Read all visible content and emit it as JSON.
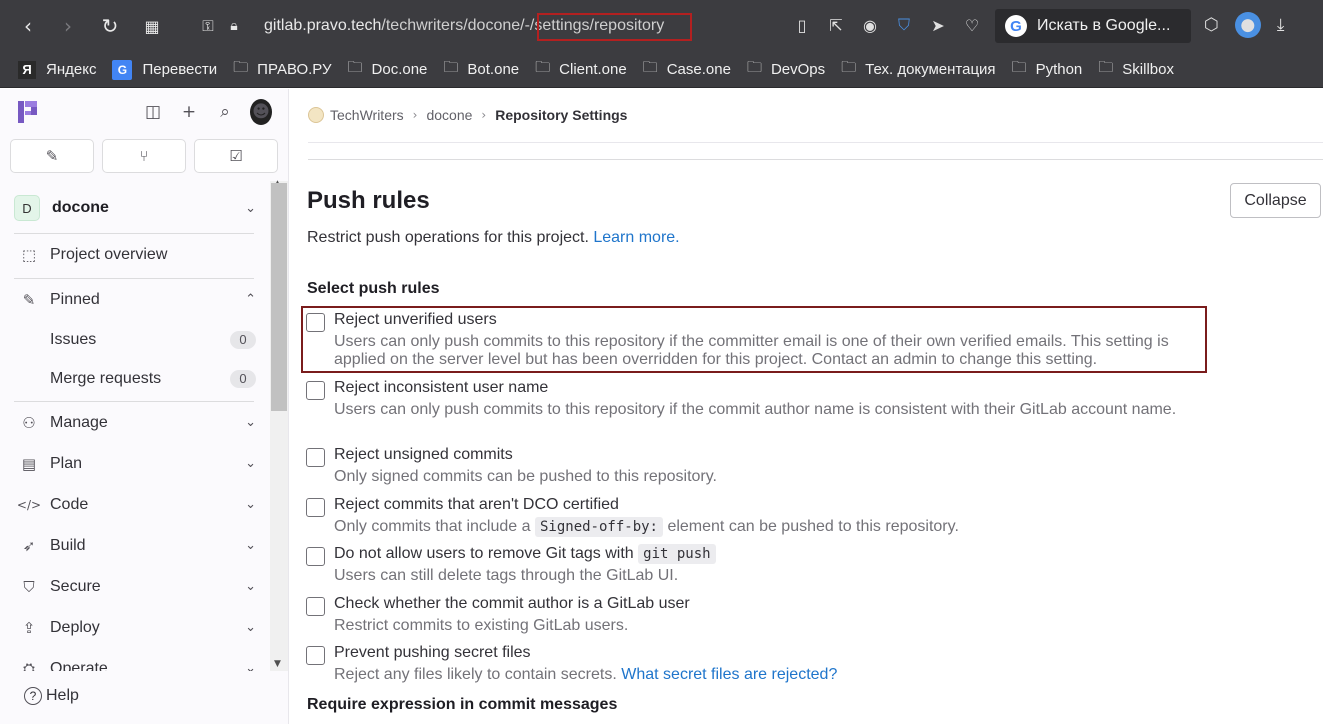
{
  "browser": {
    "url_host": "gitlab.pravo.tech",
    "url_path": "/techwriters/docone/",
    "url_highlighted": "-/settings/repository",
    "search_label": "Искать в Google...",
    "bookmarks": [
      {
        "label": "Яндекс",
        "icon": "yandex-icon"
      },
      {
        "label": "Перевести",
        "icon": "translate-icon"
      },
      {
        "label": "ПРАВО.РУ",
        "icon": "folder-icon"
      },
      {
        "label": "Doc.one",
        "icon": "folder-icon"
      },
      {
        "label": "Bot.one",
        "icon": "folder-icon"
      },
      {
        "label": "Client.one",
        "icon": "folder-icon"
      },
      {
        "label": "Case.one",
        "icon": "folder-icon"
      },
      {
        "label": "DevOps",
        "icon": "folder-icon"
      },
      {
        "label": "Тех. документация",
        "icon": "folder-icon"
      },
      {
        "label": "Python",
        "icon": "folder-icon"
      },
      {
        "label": "Skillbox",
        "icon": "folder-icon"
      }
    ]
  },
  "sidebar": {
    "project_initial": "D",
    "project_name": "docone",
    "overview": "Project overview",
    "pinned": "Pinned",
    "pinned_items": [
      {
        "label": "Issues",
        "count": "0"
      },
      {
        "label": "Merge requests",
        "count": "0"
      }
    ],
    "sections": [
      {
        "label": "Manage",
        "icon": "users-icon"
      },
      {
        "label": "Plan",
        "icon": "calendar-icon"
      },
      {
        "label": "Code",
        "icon": "code-icon"
      },
      {
        "label": "Build",
        "icon": "rocket-icon"
      },
      {
        "label": "Secure",
        "icon": "shield-icon"
      },
      {
        "label": "Deploy",
        "icon": "deploy-icon"
      },
      {
        "label": "Operate",
        "icon": "operate-icon"
      }
    ],
    "help": "Help"
  },
  "breadcrumb": {
    "group": "TechWriters",
    "project": "docone",
    "current": "Repository Settings"
  },
  "section": {
    "title": "Push rules",
    "collapse_label": "Collapse",
    "description": "Restrict push operations for this project.",
    "learn_more": "Learn more.",
    "select_title": "Select push rules",
    "require_title": "Require expression in commit messages"
  },
  "rules": [
    {
      "label": "Reject unverified users",
      "help": "Users can only push commits to this repository if the committer email is one of their own verified emails. This setting is applied on the server level but has been overridden for this project. Contact an admin to change this setting."
    },
    {
      "label": "Reject inconsistent user name",
      "help": "Users can only push commits to this repository if the commit author name is consistent with their GitLab account name."
    },
    {
      "label": "Reject unsigned commits",
      "help": "Only signed commits can be pushed to this repository."
    },
    {
      "label": "Reject commits that aren't DCO certified",
      "help_before": "Only commits that include a",
      "help_code": "Signed-off-by:",
      "help_after": "element can be pushed to this repository."
    },
    {
      "label_before": "Do not allow users to remove Git tags with",
      "label_code": "git push",
      "help": "Users can still delete tags through the GitLab UI."
    },
    {
      "label": "Check whether the commit author is a GitLab user",
      "help": "Restrict commits to existing GitLab users."
    },
    {
      "label": "Prevent pushing secret files",
      "help": "Reject any files likely to contain secrets.",
      "help_link": "What secret files are rejected?"
    }
  ]
}
